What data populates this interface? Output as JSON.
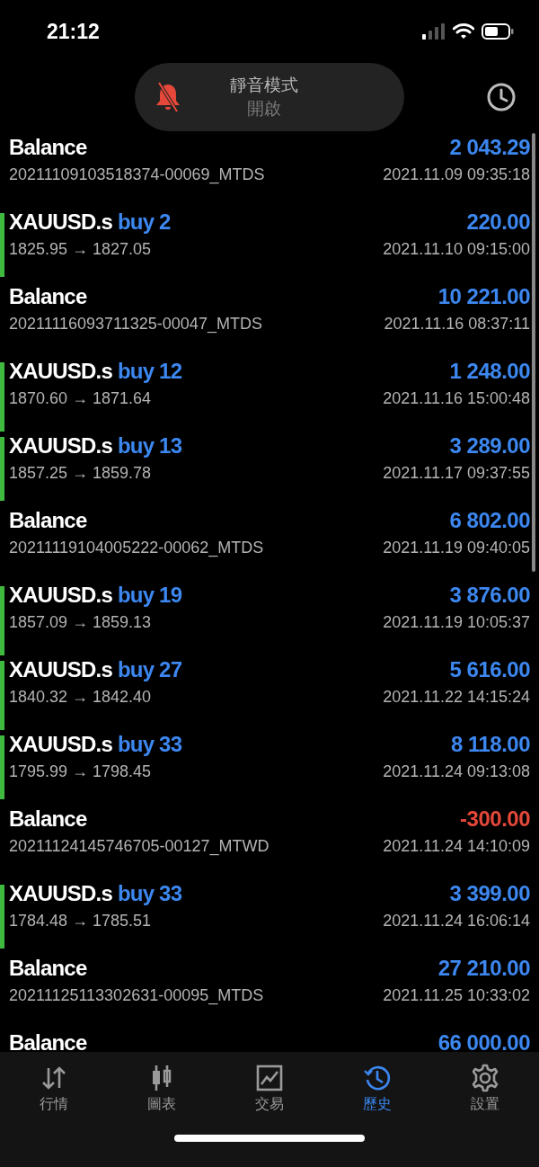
{
  "status_bar": {
    "time": "21:12"
  },
  "silent_banner": {
    "title": "靜音模式",
    "subtitle": "開啟"
  },
  "rows": [
    {
      "kind": "balance",
      "title": "Balance",
      "amount": "2 043.29",
      "negative": false,
      "detail": "20211109103518374-00069_MTDS",
      "time": "2021.11.09 09:35:18"
    },
    {
      "kind": "trade",
      "title": "XAUUSD.s",
      "side": "buy 2",
      "amount": "220.00",
      "negative": false,
      "detail": "1825.95 → 1827.05",
      "time": "2021.11.10 09:15:00"
    },
    {
      "kind": "balance",
      "title": "Balance",
      "amount": "10 221.00",
      "negative": false,
      "detail": "20211116093711325-00047_MTDS",
      "time": "2021.11.16 08:37:11"
    },
    {
      "kind": "trade",
      "title": "XAUUSD.s",
      "side": "buy 12",
      "amount": "1 248.00",
      "negative": false,
      "detail": "1870.60 → 1871.64",
      "time": "2021.11.16 15:00:48"
    },
    {
      "kind": "trade",
      "title": "XAUUSD.s",
      "side": "buy 13",
      "amount": "3 289.00",
      "negative": false,
      "detail": "1857.25 → 1859.78",
      "time": "2021.11.17 09:37:55"
    },
    {
      "kind": "balance",
      "title": "Balance",
      "amount": "6 802.00",
      "negative": false,
      "detail": "20211119104005222-00062_MTDS",
      "time": "2021.11.19 09:40:05"
    },
    {
      "kind": "trade",
      "title": "XAUUSD.s",
      "side": "buy 19",
      "amount": "3 876.00",
      "negative": false,
      "detail": "1857.09 → 1859.13",
      "time": "2021.11.19 10:05:37"
    },
    {
      "kind": "trade",
      "title": "XAUUSD.s",
      "side": "buy 27",
      "amount": "5 616.00",
      "negative": false,
      "detail": "1840.32 → 1842.40",
      "time": "2021.11.22 14:15:24"
    },
    {
      "kind": "trade",
      "title": "XAUUSD.s",
      "side": "buy 33",
      "amount": "8 118.00",
      "negative": false,
      "detail": "1795.99 → 1798.45",
      "time": "2021.11.24 09:13:08"
    },
    {
      "kind": "balance",
      "title": "Balance",
      "amount": "-300.00",
      "negative": true,
      "detail": "20211124145746705-00127_MTWD",
      "time": "2021.11.24 14:10:09"
    },
    {
      "kind": "trade",
      "title": "XAUUSD.s",
      "side": "buy 33",
      "amount": "3 399.00",
      "negative": false,
      "detail": "1784.48 → 1785.51",
      "time": "2021.11.24 16:06:14"
    },
    {
      "kind": "balance",
      "title": "Balance",
      "amount": "27 210.00",
      "negative": false,
      "detail": "20211125113302631-00095_MTDS",
      "time": "2021.11.25 10:33:02"
    },
    {
      "kind": "balance",
      "title": "Balance",
      "amount": "66 000.00",
      "negative": false
    }
  ],
  "tabs": [
    {
      "kind": "quotes",
      "label": "行情",
      "selected": false
    },
    {
      "kind": "charts",
      "label": "圖表",
      "selected": false
    },
    {
      "kind": "trade",
      "label": "交易",
      "selected": false
    },
    {
      "kind": "history",
      "label": "歷史",
      "selected": true
    },
    {
      "kind": "settings",
      "label": "設置",
      "selected": false
    }
  ]
}
